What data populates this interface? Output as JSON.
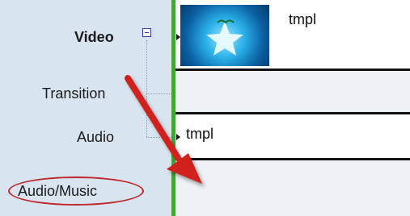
{
  "tracks": {
    "video_label": "Video",
    "transition_label": "Transition",
    "audio_label": "Audio",
    "audio_music_label": "Audio/Music"
  },
  "clips": {
    "video_clip_title": "tmpl",
    "audio_clip_title": "tmpl"
  },
  "icons": {
    "collapse": "minus-box-icon",
    "thumbnail": "star-thumbnail",
    "annotation_arrow": "red-arrow-icon"
  },
  "colors": {
    "header_bg": "#d8e4ef",
    "playhead": "#3fa63a",
    "annotation": "#c0282d"
  }
}
